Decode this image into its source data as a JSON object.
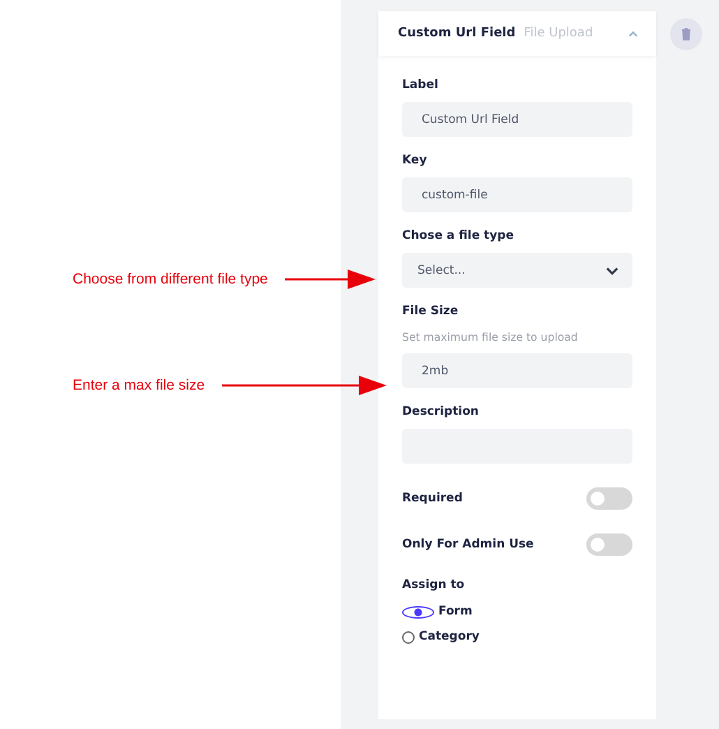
{
  "annotations": [
    {
      "text": "Choose from different file type"
    },
    {
      "text": "Enter a max file size"
    }
  ],
  "card": {
    "title": "Custom Url Field",
    "type": "File Upload",
    "expanded": true
  },
  "fields": [
    {
      "kind": "text",
      "label": "Label",
      "value": "Custom Url Field"
    },
    {
      "kind": "text",
      "label": "Key",
      "value": "custom-file"
    },
    {
      "kind": "select",
      "label": "Chose a file type",
      "value": "Select..."
    },
    {
      "kind": "text",
      "label": "File Size",
      "hint": "Set maximum file size to upload",
      "value": "2mb"
    },
    {
      "kind": "text",
      "label": "Description"
    }
  ],
  "toggles": [
    {
      "label": "Required",
      "on": false
    },
    {
      "label": "Only For Admin Use",
      "on": false
    }
  ],
  "assign": {
    "label": "Assign to",
    "options": [
      {
        "label": "Form",
        "selected": true
      },
      {
        "label": "Category",
        "selected": false
      }
    ]
  }
}
